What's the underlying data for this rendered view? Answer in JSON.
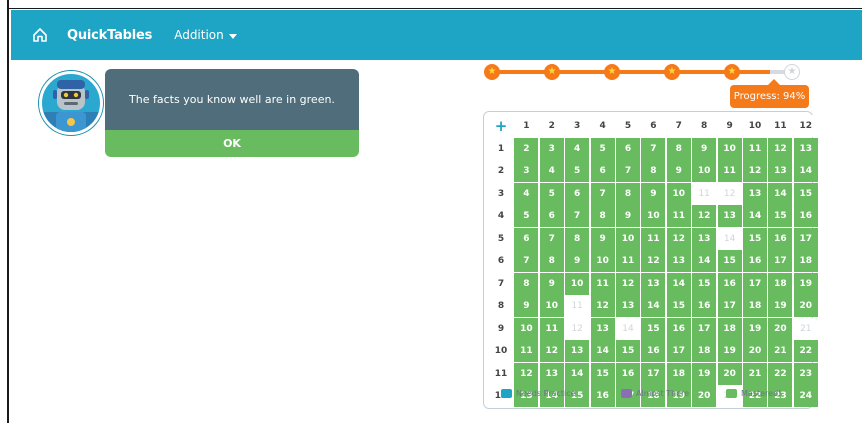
{
  "header": {
    "brand": "QuickTables",
    "menu_label": "Addition",
    "bg_color": "#1ea4c4"
  },
  "dialog": {
    "message": "The facts you know well are in green.",
    "ok_label": "OK"
  },
  "progress": {
    "label": "Progress: 94%",
    "value_percent": 94,
    "stars_total": 6,
    "stars_earned": 5,
    "color": "#f47a1a"
  },
  "table": {
    "operator_symbol": "+",
    "col_headers": [
      "1",
      "2",
      "3",
      "4",
      "5",
      "6",
      "7",
      "8",
      "9",
      "10",
      "11",
      "12"
    ],
    "row_headers": [
      "1",
      "2",
      "3",
      "4",
      "5",
      "6",
      "7",
      "8",
      "9",
      "10",
      "11",
      "12"
    ],
    "not_mastered": [
      [
        3,
        8
      ],
      [
        3,
        9
      ],
      [
        5,
        9
      ],
      [
        8,
        3
      ],
      [
        9,
        3
      ],
      [
        9,
        5
      ],
      [
        9,
        12
      ],
      [
        12,
        9
      ]
    ],
    "mastered_color": "#68bb5f"
  },
  "legend": {
    "needs_practice": "Needs Practice",
    "almost_there": "Almost There",
    "mastered": "Mastered!",
    "needs_color": "#1ea4c4",
    "almost_color": "#8a6fb5",
    "mastered_color": "#68bb5f"
  }
}
